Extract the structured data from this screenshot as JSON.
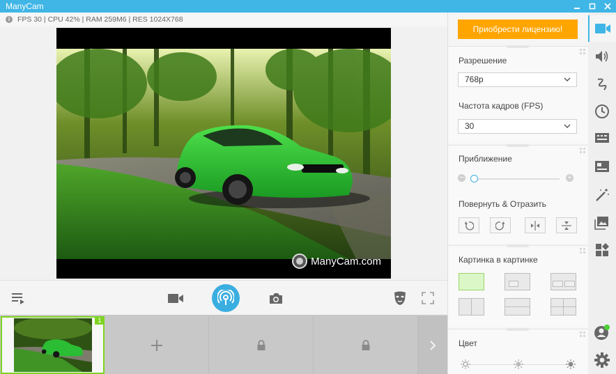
{
  "window": {
    "title": "ManyCam"
  },
  "stats": {
    "text": "FPS 30 | CPU 42% | RAM 259M6 | RES 1024X768"
  },
  "preview": {
    "watermark": "ManyCam.com"
  },
  "thumbnails": {
    "active_badge": "1"
  },
  "panel": {
    "buy_label": "Приобрести лицензию!",
    "resolution_label": "Разрешение",
    "resolution_value": "768p",
    "fps_label": "Частота кадров (FPS)",
    "fps_value": "30",
    "zoom_label": "Приближение",
    "zoom_level": 0.0,
    "rotate_label": "Повернуть & Отразить",
    "pip_label": "Картинка в картинке",
    "color_label": "Цвет"
  },
  "colors": {
    "accent": "#3fb6e6",
    "buy_button": "#ffa500",
    "active_green": "#7ed321"
  },
  "icons": {
    "rail": [
      "video-icon",
      "audio-icon",
      "draw-icon",
      "clock-icon",
      "subtitles-icon",
      "lower-third-icon",
      "effects-icon",
      "images-icon",
      "widgets-icon",
      "profile-icon",
      "settings-icon"
    ],
    "controls": [
      "playlist-icon",
      "camera-icon",
      "broadcast-icon",
      "snapshot-icon",
      "mask-icon",
      "fullscreen-icon"
    ]
  }
}
